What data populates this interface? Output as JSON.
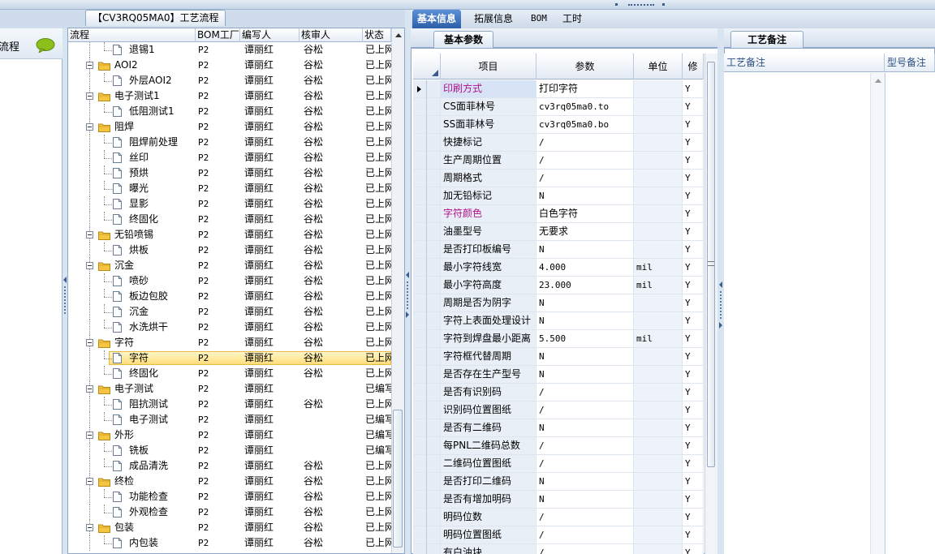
{
  "process_panel": {
    "tab_title": "【CV3RQ05MA0】工艺流程",
    "columns": [
      "流程",
      "BOM工厂",
      "编写人",
      "核审人",
      "状态"
    ],
    "rows": [
      {
        "level": 2,
        "type": "doc",
        "name": "退锡1",
        "bom": "P2",
        "writer": "谭丽红",
        "reviewer": "谷松",
        "status": "已上网"
      },
      {
        "level": 1,
        "type": "folder",
        "name": "AOI2",
        "bom": "P2",
        "writer": "谭丽红",
        "reviewer": "谷松",
        "status": "已上网"
      },
      {
        "level": 2,
        "type": "doc",
        "name": "外层AOI2",
        "bom": "P2",
        "writer": "谭丽红",
        "reviewer": "谷松",
        "status": "已上网"
      },
      {
        "level": 1,
        "type": "folder",
        "name": "电子测试1",
        "bom": "P2",
        "writer": "谭丽红",
        "reviewer": "谷松",
        "status": "已上网"
      },
      {
        "level": 2,
        "type": "doc",
        "name": "低阻测试1",
        "bom": "P2",
        "writer": "谭丽红",
        "reviewer": "谷松",
        "status": "已上网"
      },
      {
        "level": 1,
        "type": "folder",
        "name": "阻焊",
        "bom": "P2",
        "writer": "谭丽红",
        "reviewer": "谷松",
        "status": "已上网"
      },
      {
        "level": 2,
        "type": "doc",
        "name": "阻焊前处理",
        "bom": "P2",
        "writer": "谭丽红",
        "reviewer": "谷松",
        "status": "已上网"
      },
      {
        "level": 2,
        "type": "doc",
        "name": "丝印",
        "bom": "P2",
        "writer": "谭丽红",
        "reviewer": "谷松",
        "status": "已上网"
      },
      {
        "level": 2,
        "type": "doc",
        "name": "预烘",
        "bom": "P2",
        "writer": "谭丽红",
        "reviewer": "谷松",
        "status": "已上网"
      },
      {
        "level": 2,
        "type": "doc",
        "name": "曝光",
        "bom": "P2",
        "writer": "谭丽红",
        "reviewer": "谷松",
        "status": "已上网"
      },
      {
        "level": 2,
        "type": "doc",
        "name": "显影",
        "bom": "P2",
        "writer": "谭丽红",
        "reviewer": "谷松",
        "status": "已上网"
      },
      {
        "level": 2,
        "type": "doc",
        "name": "终固化",
        "bom": "P2",
        "writer": "谭丽红",
        "reviewer": "谷松",
        "status": "已上网"
      },
      {
        "level": 1,
        "type": "folder",
        "name": "无铅喷锡",
        "bom": "P2",
        "writer": "谭丽红",
        "reviewer": "谷松",
        "status": "已上网"
      },
      {
        "level": 2,
        "type": "doc",
        "name": "烘板",
        "bom": "P2",
        "writer": "谭丽红",
        "reviewer": "谷松",
        "status": "已上网"
      },
      {
        "level": 1,
        "type": "folder",
        "name": "沉金",
        "bom": "P2",
        "writer": "谭丽红",
        "reviewer": "谷松",
        "status": "已上网"
      },
      {
        "level": 2,
        "type": "doc",
        "name": "喷砂",
        "bom": "P2",
        "writer": "谭丽红",
        "reviewer": "谷松",
        "status": "已上网"
      },
      {
        "level": 2,
        "type": "doc",
        "name": "板边包胶",
        "bom": "P2",
        "writer": "谭丽红",
        "reviewer": "谷松",
        "status": "已上网"
      },
      {
        "level": 2,
        "type": "doc",
        "name": "沉金",
        "bom": "P2",
        "writer": "谭丽红",
        "reviewer": "谷松",
        "status": "已上网"
      },
      {
        "level": 2,
        "type": "doc",
        "name": "水洗烘干",
        "bom": "P2",
        "writer": "谭丽红",
        "reviewer": "谷松",
        "status": "已上网"
      },
      {
        "level": 1,
        "type": "folder",
        "name": "字符",
        "bom": "P2",
        "writer": "谭丽红",
        "reviewer": "谷松",
        "status": "已上网"
      },
      {
        "level": 2,
        "type": "doc",
        "name": "字符",
        "bom": "P2",
        "writer": "谭丽红",
        "reviewer": "谷松",
        "status": "已上网",
        "selected": true
      },
      {
        "level": 2,
        "type": "doc",
        "name": "终固化",
        "bom": "P2",
        "writer": "谭丽红",
        "reviewer": "谷松",
        "status": "已上网"
      },
      {
        "level": 1,
        "type": "folder",
        "name": "电子测试",
        "bom": "P2",
        "writer": "谭丽红",
        "reviewer": "",
        "status": "已编写"
      },
      {
        "level": 2,
        "type": "doc",
        "name": "阻抗测试",
        "bom": "P2",
        "writer": "谭丽红",
        "reviewer": "谷松",
        "status": "已上网"
      },
      {
        "level": 2,
        "type": "doc",
        "name": "电子测试",
        "bom": "P2",
        "writer": "谭丽红",
        "reviewer": "",
        "status": "已编写"
      },
      {
        "level": 1,
        "type": "folder",
        "name": "外形",
        "bom": "P2",
        "writer": "谭丽红",
        "reviewer": "",
        "status": "已编写"
      },
      {
        "level": 2,
        "type": "doc",
        "name": "铣板",
        "bom": "P2",
        "writer": "谭丽红",
        "reviewer": "",
        "status": "已编写"
      },
      {
        "level": 2,
        "type": "doc",
        "name": "成品清洗",
        "bom": "P2",
        "writer": "谭丽红",
        "reviewer": "谷松",
        "status": "已上网"
      },
      {
        "level": 1,
        "type": "folder",
        "name": "终检",
        "bom": "P2",
        "writer": "谭丽红",
        "reviewer": "谷松",
        "status": "已上网"
      },
      {
        "level": 2,
        "type": "doc",
        "name": "功能检查",
        "bom": "P2",
        "writer": "谭丽红",
        "reviewer": "谷松",
        "status": "已上网"
      },
      {
        "level": 2,
        "type": "doc",
        "name": "外观检查",
        "bom": "P2",
        "writer": "谭丽红",
        "reviewer": "谷松",
        "status": "已上网"
      },
      {
        "level": 1,
        "type": "folder",
        "name": "包装",
        "bom": "P2",
        "writer": "谭丽红",
        "reviewer": "谷松",
        "status": "已上网"
      },
      {
        "level": 2,
        "type": "doc",
        "name": "内包装",
        "bom": "P2",
        "writer": "谭丽红",
        "reviewer": "谷松",
        "status": "已上网"
      }
    ]
  },
  "left_nav": {
    "label": "流程",
    "icon": "speech-bubble-icon"
  },
  "top_tabs": [
    "基本信息",
    "拓展信息",
    "BOM",
    "工时"
  ],
  "basic_panel": {
    "subtab": "基本参数",
    "columns": [
      "项目",
      "参数",
      "单位",
      "修"
    ],
    "rows": [
      {
        "item": "印刷方式",
        "param": "打印字符",
        "unit": "",
        "flag": "Y",
        "hi": true
      },
      {
        "item": "CS面菲林号",
        "param": "cv3rq05ma0.to",
        "unit": "",
        "flag": "Y"
      },
      {
        "item": "SS面菲林号",
        "param": "cv3rq05ma0.bo",
        "unit": "",
        "flag": "Y"
      },
      {
        "item": "快捷标记",
        "param": "/",
        "unit": "",
        "flag": "Y"
      },
      {
        "item": "生产周期位置",
        "param": "/",
        "unit": "",
        "flag": "Y"
      },
      {
        "item": "周期格式",
        "param": "/",
        "unit": "",
        "flag": "Y"
      },
      {
        "item": "加无铅标记",
        "param": "N",
        "unit": "",
        "flag": "Y"
      },
      {
        "item": "字符颜色",
        "param": "白色字符",
        "unit": "",
        "flag": "Y",
        "hi": true
      },
      {
        "item": "油墨型号",
        "param": "无要求",
        "unit": "",
        "flag": "Y"
      },
      {
        "item": "是否打印板编号",
        "param": "N",
        "unit": "",
        "flag": "Y"
      },
      {
        "item": "最小字符线宽",
        "param": "4.000",
        "unit": "mil",
        "flag": "Y"
      },
      {
        "item": "最小字符高度",
        "param": "23.000",
        "unit": "mil",
        "flag": "Y"
      },
      {
        "item": "周期是否为阴字",
        "param": "N",
        "unit": "",
        "flag": "Y"
      },
      {
        "item": "字符上表面处理设计",
        "param": "N",
        "unit": "",
        "flag": "Y"
      },
      {
        "item": "字符到焊盘最小距离",
        "param": "5.500",
        "unit": "mil",
        "flag": "Y"
      },
      {
        "item": "字符框代替周期",
        "param": "N",
        "unit": "",
        "flag": "Y"
      },
      {
        "item": "是否存在生产型号",
        "param": "N",
        "unit": "",
        "flag": "Y"
      },
      {
        "item": "是否有识别码",
        "param": "/",
        "unit": "",
        "flag": "Y"
      },
      {
        "item": "识别码位置图纸",
        "param": "/",
        "unit": "",
        "flag": "Y"
      },
      {
        "item": "是否有二维码",
        "param": "N",
        "unit": "",
        "flag": "Y"
      },
      {
        "item": "每PNL二维码总数",
        "param": "/",
        "unit": "",
        "flag": "Y"
      },
      {
        "item": "二维码位置图纸",
        "param": "/",
        "unit": "",
        "flag": "Y"
      },
      {
        "item": "是否打印二维码",
        "param": "N",
        "unit": "",
        "flag": "Y"
      },
      {
        "item": "是否有增加明码",
        "param": "N",
        "unit": "",
        "flag": "Y"
      },
      {
        "item": "明码位数",
        "param": "/",
        "unit": "",
        "flag": "Y"
      },
      {
        "item": "明码位置图纸",
        "param": "/",
        "unit": "",
        "flag": "Y"
      },
      {
        "item": "有白油块",
        "param": "/",
        "unit": "",
        "flag": "Y"
      }
    ]
  },
  "notes_panel": {
    "subtab": "工艺备注",
    "columns": [
      "工艺备注",
      "型号备注"
    ]
  }
}
